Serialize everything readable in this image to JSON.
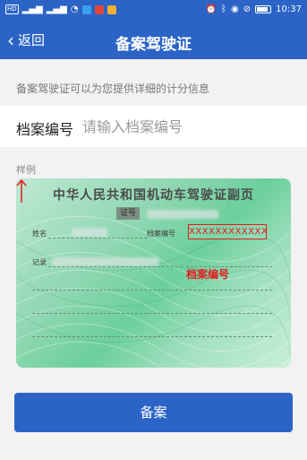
{
  "status_bar": {
    "left_chips": [
      "HD",
      "4G",
      "4G"
    ],
    "time": "10:37"
  },
  "header": {
    "back_label": "返回",
    "title": "备案驾驶证"
  },
  "form": {
    "hint": "备案驾驶证可以为您提供详细的计分信息",
    "field_label": "档案编号",
    "field_placeholder": "请输入档案编号",
    "field_value": ""
  },
  "sample": {
    "label": "样例",
    "card_title": "中华人民共和国机动车驾驶证副页",
    "license_no_label": "证号",
    "name_label": "姓名",
    "file_no_label": "档案编号",
    "record_label": "记录",
    "file_no_value": "XXXXXXXXXXXX",
    "annotation": "档案编号"
  },
  "submit_label": "备案",
  "colors": {
    "brand_blue": "#2b64c6",
    "highlight_red": "#e01d1d",
    "card_green": "#6ccf9c"
  },
  "icons": {
    "back": "chevron-left-icon",
    "arrow": "arrow-up-icon"
  }
}
